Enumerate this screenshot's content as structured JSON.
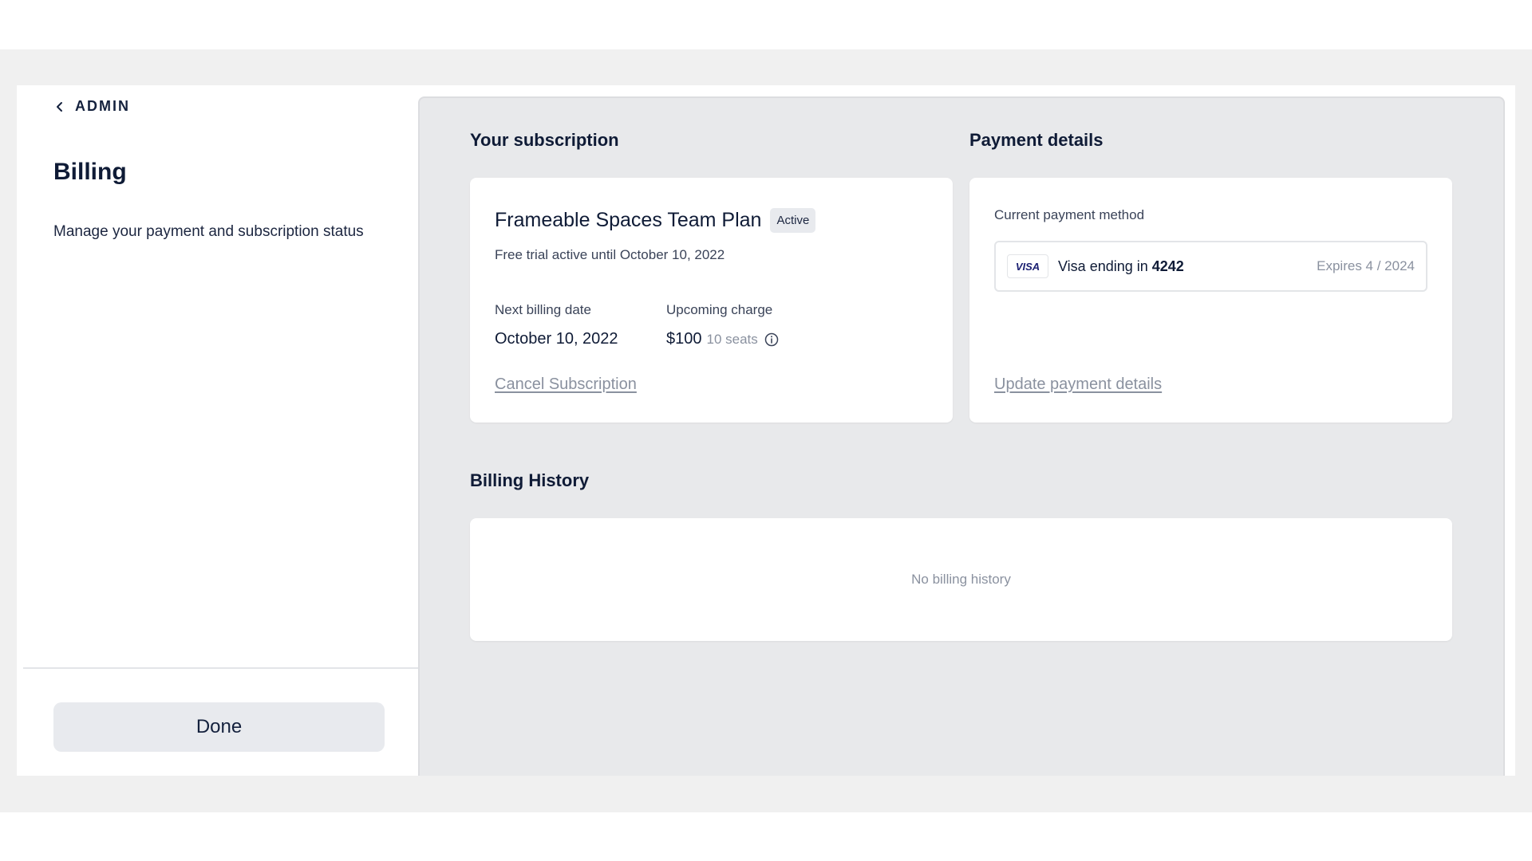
{
  "sidebar": {
    "back_label": "ADMIN",
    "title": "Billing",
    "description": "Manage your payment and subscription status",
    "done_label": "Done"
  },
  "subscription": {
    "section_title": "Your subscription",
    "plan_name": "Frameable Spaces Team Plan",
    "status_badge": "Active",
    "trial_text": "Free trial active until October 10, 2022",
    "next_billing_label": "Next billing date",
    "next_billing_value": "October 10, 2022",
    "upcoming_charge_label": "Upcoming charge",
    "upcoming_charge_value": "$100",
    "seats": "10 seats",
    "cancel_label": "Cancel Subscription"
  },
  "payment": {
    "section_title": "Payment details",
    "current_label": "Current payment method",
    "card_brand": "VISA",
    "card_text": "Visa ending in",
    "card_last4": "4242",
    "expires": "Expires 4 / 2024",
    "update_label": "Update payment details"
  },
  "history": {
    "section_title": "Billing History",
    "empty_text": "No billing history"
  },
  "icons": {
    "back": "chevron-left-icon",
    "info": "info-circle-icon"
  }
}
